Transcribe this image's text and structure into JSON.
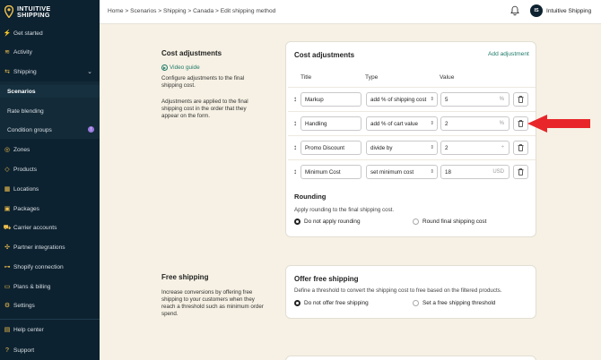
{
  "brand": {
    "line1": "INTUITIVE",
    "line2": "SHIPPING"
  },
  "sidebar": {
    "items": [
      {
        "label": "Get started",
        "icon": "bolt-icon"
      },
      {
        "label": "Activity",
        "icon": "activity-icon"
      },
      {
        "label": "Shipping",
        "icon": "scenarios-icon"
      },
      {
        "label": "Scenarios"
      },
      {
        "label": "Rate blending"
      },
      {
        "label": "Condition groups",
        "badge": "!"
      },
      {
        "label": "Zones",
        "icon": "globe-icon"
      },
      {
        "label": "Products",
        "icon": "tag-icon"
      },
      {
        "label": "Locations",
        "icon": "building-icon"
      },
      {
        "label": "Packages",
        "icon": "box-icon"
      },
      {
        "label": "Carrier accounts",
        "icon": "truck-icon"
      },
      {
        "label": "Partner integrations",
        "icon": "plug-icon"
      },
      {
        "label": "Shopify connection",
        "icon": "link-icon"
      },
      {
        "label": "Plans & billing",
        "icon": "card-icon"
      },
      {
        "label": "Settings",
        "icon": "gear-icon"
      },
      {
        "label": "Help center",
        "icon": "help-icon"
      },
      {
        "label": "Support",
        "icon": "question-icon"
      }
    ]
  },
  "topbar": {
    "breadcrumb": "Home > Scenarios > Shipping > Canada > Edit shipping method",
    "avatar_initials": "IS",
    "username": "Intuitive Shipping"
  },
  "cost_section": {
    "title": "Cost adjustments",
    "video_link": "Video guide",
    "desc1": "Configure adjustments to the final shipping cost.",
    "desc2": "Adjustments are applied to the final shipping cost in the order that they appear on the form."
  },
  "cost_card": {
    "title": "Cost adjustments",
    "add_label": "Add adjustment",
    "col_title": "Title",
    "col_type": "Type",
    "col_value": "Value",
    "rows": [
      {
        "title": "Markup",
        "type": "add % of shipping cost",
        "value": "5",
        "suffix": "%"
      },
      {
        "title": "Handling",
        "type": "add % of cart value",
        "value": "2",
        "suffix": "%"
      },
      {
        "title": "Promo Discount",
        "type": "divide by",
        "value": "2",
        "suffix": ""
      },
      {
        "title": "Minimum Cost",
        "type": "set minimum cost",
        "value": "18",
        "suffix": "USD"
      }
    ],
    "rounding_title": "Rounding",
    "rounding_hint": "Apply rounding to the final shipping cost.",
    "rounding_options": [
      "Do not apply rounding",
      "Round final shipping cost"
    ]
  },
  "free_section": {
    "title": "Free shipping",
    "desc": "Increase conversions by offering free shipping to your customers when they reach a threshold such as minimum order spend."
  },
  "free_card": {
    "title": "Offer free shipping",
    "hint": "Define a threshold to convert the shipping cost to free based on the filtered products.",
    "options": [
      "Do not offer free shipping",
      "Set a free shipping threshold"
    ]
  },
  "colors": {
    "sidebar": "#0d2230",
    "accent": "#1f7a6a",
    "arrow": "#e8262a",
    "background": "#f6f1e4"
  }
}
